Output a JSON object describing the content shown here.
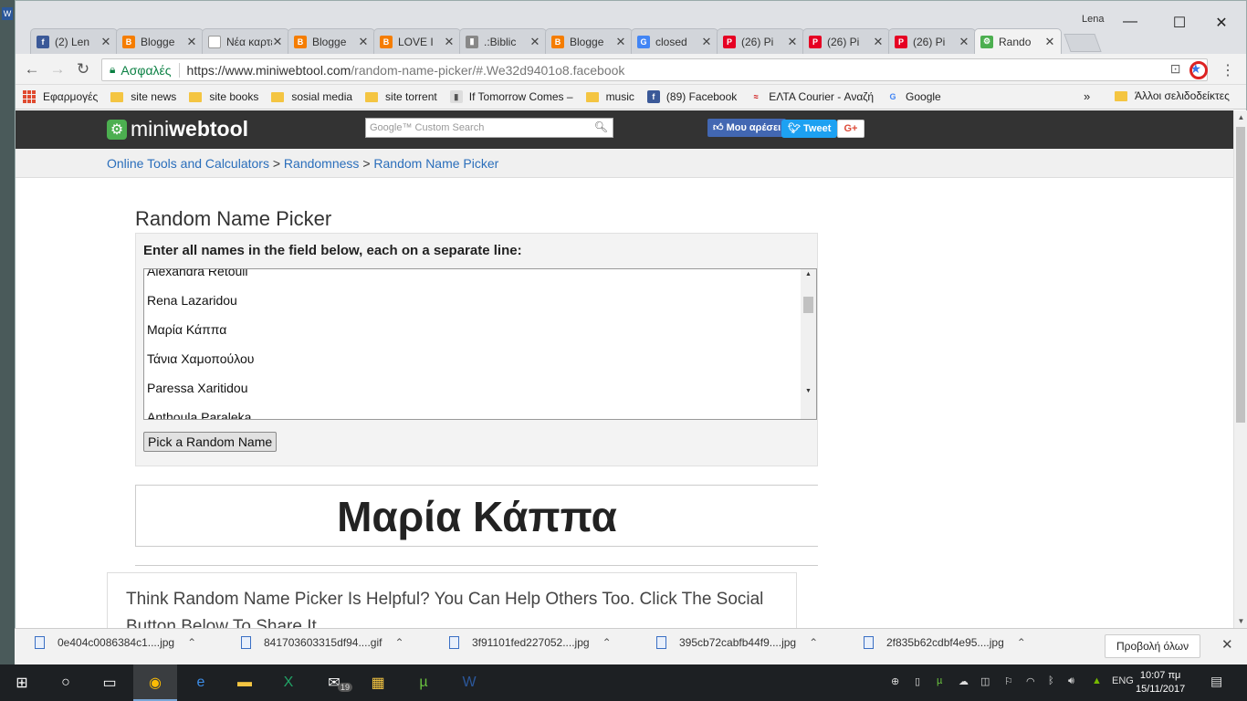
{
  "browser": {
    "tabs": [
      {
        "label": "(2) Len",
        "icon": "facebook-icon",
        "color": "#3b5998",
        "glyph": "f"
      },
      {
        "label": "Blogge",
        "icon": "blogger-icon",
        "color": "#f57d00",
        "glyph": "B"
      },
      {
        "label": "Νέα καρτε",
        "icon": "blank-page-icon",
        "color": "#ffffff",
        "glyph": ""
      },
      {
        "label": "Blogge",
        "icon": "blogger-icon",
        "color": "#f57d00",
        "glyph": "B"
      },
      {
        "label": "LOVE I",
        "icon": "blogger-icon",
        "color": "#f57d00",
        "glyph": "B"
      },
      {
        "label": ".:Biblic",
        "icon": "page-icon",
        "color": "#888888",
        "glyph": "▮"
      },
      {
        "label": "Blogge",
        "icon": "blogger-icon",
        "color": "#f57d00",
        "glyph": "B"
      },
      {
        "label": "closed",
        "icon": "google-icon",
        "color": "#4285f4",
        "glyph": "G"
      },
      {
        "label": "(26) Pi",
        "icon": "pinterest-icon",
        "color": "#e60023",
        "glyph": "P"
      },
      {
        "label": "(26) Pi",
        "icon": "pinterest-icon",
        "color": "#e60023",
        "glyph": "P"
      },
      {
        "label": "(26) Pi",
        "icon": "pinterest-icon",
        "color": "#e60023",
        "glyph": "P"
      },
      {
        "label": "Rando",
        "icon": "miniwebtool-icon",
        "color": "#4caf50",
        "glyph": "⚙",
        "active": true
      }
    ],
    "user_name": "Lena",
    "window_controls": {
      "minimize": "—",
      "maximize": "☐",
      "close": "✕"
    },
    "omnibox": {
      "secure_label": "Ασφαλές",
      "url_host": "https://www.miniwebtool.com",
      "url_path": "/random-name-picker/#.We32d9401o8.facebook"
    },
    "bookmarks": [
      {
        "label": "Εφαρμογές",
        "type": "apps"
      },
      {
        "label": "site news",
        "type": "folder"
      },
      {
        "label": "site books",
        "type": "folder"
      },
      {
        "label": "sosial media",
        "type": "folder"
      },
      {
        "label": "site torrent",
        "type": "folder"
      },
      {
        "label": "If Tomorrow Comes –",
        "type": "page"
      },
      {
        "label": "music",
        "type": "folder"
      },
      {
        "label": "(89) Facebook",
        "type": "facebook"
      },
      {
        "label": "ΕΛΤΑ Courier - Αναζή",
        "type": "elta"
      },
      {
        "label": "Google",
        "type": "google"
      }
    ],
    "more_bookmarks": "»",
    "other_bookmarks": "Άλλοι σελιδοδείκτες"
  },
  "site": {
    "logo_light": "mini",
    "logo_bold": "webtool",
    "search_brand": "Google™ Custom Search",
    "fb_like": "Μου αρέσει",
    "tweet": "Tweet",
    "gplus": "G+",
    "breadcrumb": [
      "Online Tools and Calculators",
      "Randomness",
      "Random Name Picker"
    ],
    "breadcrumb_sep": ">"
  },
  "tool": {
    "title": "Random Name Picker",
    "label": "Enter all names in the field below, each on a separate line:",
    "names": [
      "Alexandra Retouli",
      "Rena Lazaridou",
      "Μαρία Κάππα",
      "Τάνια Χαμοπούλου",
      "Paressa Xaritidou",
      "Anthoula Paraleka"
    ],
    "button_label": "Pick a Random Name",
    "result": "Μαρία Κάππα",
    "share_text": "Think Random Name Picker Is Helpful? You Can Help Others Too. Click The Social Button Below To Share It."
  },
  "downloads": {
    "files": [
      "0e404c0086384c1....jpg",
      "841703603315df94....gif",
      "3f91101fed227052....jpg",
      "395cb72cabfb44f9....jpg",
      "2f835b62cdbf4e95....jpg"
    ],
    "show_all": "Προβολή όλων"
  },
  "taskbar": {
    "mail_badge": "19",
    "language": "ENG",
    "time": "10:07 πμ",
    "date": "15/11/2017"
  }
}
